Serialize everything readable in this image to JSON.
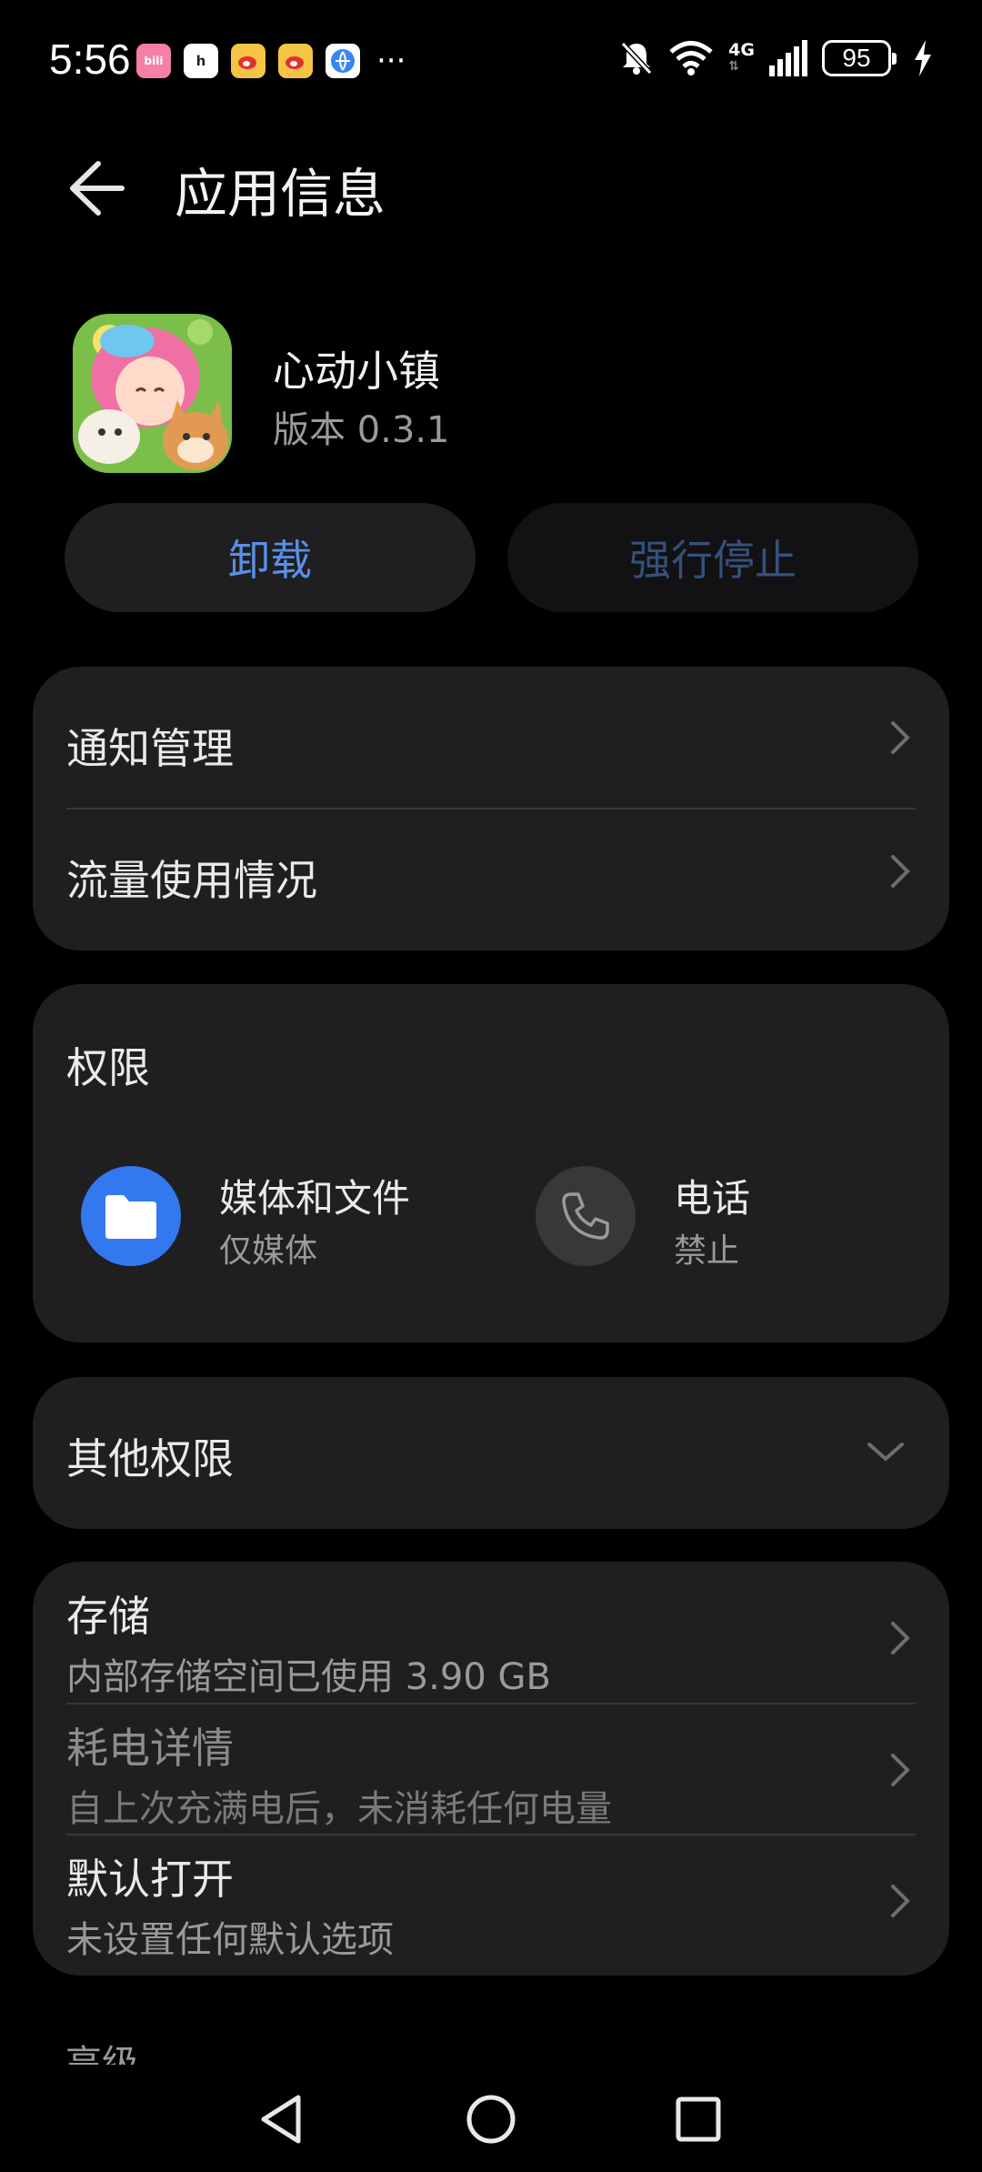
{
  "status_bar": {
    "time": "5:56",
    "battery": "95",
    "network": "4G",
    "notification_icons": [
      {
        "name": "bilibili-icon",
        "text": "bili",
        "color": "#f57fa6"
      },
      {
        "name": "hello-app-icon",
        "text": "h",
        "color": "#ffffff"
      },
      {
        "name": "weibo-icon",
        "text": "",
        "color": "#f6c445"
      },
      {
        "name": "weibo-icon-2",
        "text": "",
        "color": "#f6c445"
      },
      {
        "name": "browser-icon",
        "text": "",
        "color": "#3a86f0"
      }
    ],
    "more": "···"
  },
  "header": {
    "title": "应用信息"
  },
  "app": {
    "name": "心动小镇",
    "version": "版本 0.3.1"
  },
  "buttons": {
    "uninstall": "卸载",
    "force_stop": "强行停止"
  },
  "settings_card": {
    "notification_management": "通知管理",
    "data_usage": "流量使用情况"
  },
  "permissions": {
    "title": "权限",
    "items": [
      {
        "name": "媒体和文件",
        "status": "仅媒体"
      },
      {
        "name": "电话",
        "status": "禁止"
      }
    ]
  },
  "other_permissions": {
    "label": "其他权限"
  },
  "details_card": {
    "storage_title": "存储",
    "storage_desc": "内部存储空间已使用 3.90 GB",
    "battery_title": "耗电详情",
    "battery_desc": "自上次充满电后，未消耗任何电量",
    "default_open_title": "默认打开",
    "default_open_desc": "未设置任何默认选项"
  },
  "advanced": {
    "label": "高级"
  },
  "colors": {
    "background": "#000000",
    "card": "#1f1f21",
    "accent_blue": "#5b8fe8",
    "disabled_blue": "#35507c",
    "media_icon_bg": "#3478f0"
  }
}
